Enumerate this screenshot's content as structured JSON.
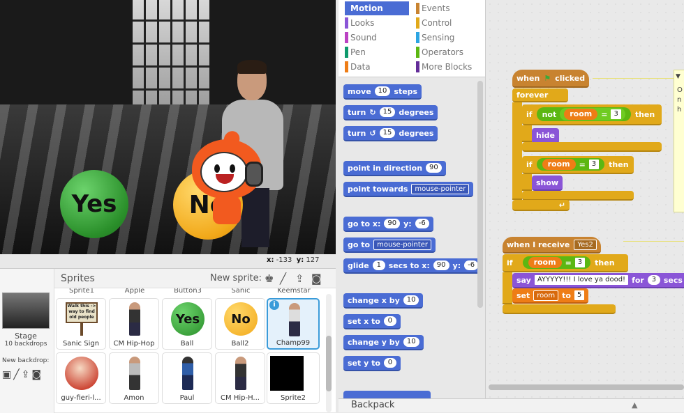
{
  "stage": {
    "yes_label": "Yes",
    "no_label": "No",
    "coords": {
      "x_label": "x:",
      "x_value": "-133",
      "y_label": "y:",
      "y_value": "127"
    }
  },
  "sprites_pane": {
    "title": "Sprites",
    "new_sprite_label": "New sprite:",
    "stage": {
      "label": "Stage",
      "backdrops": "10 backdrops"
    },
    "new_backdrop_label": "New backdrop:",
    "cut_labels": [
      "Sprite1",
      "Apple",
      "Button3",
      "Sanic",
      "Keemstar"
    ],
    "sprites": [
      {
        "name": "Sanic Sign",
        "sign_text": "Walk this -> way to find old people"
      },
      {
        "name": "CM Hip-Hop"
      },
      {
        "name": "Ball",
        "ball_text": "Yes"
      },
      {
        "name": "Ball2",
        "ball_text": "No"
      },
      {
        "name": "Champ99",
        "selected": true,
        "info": "i"
      },
      {
        "name": "guy-fieri-l..."
      },
      {
        "name": "Amon"
      },
      {
        "name": "Paul"
      },
      {
        "name": "CM Hip-H..."
      },
      {
        "name": "Sprite2"
      }
    ]
  },
  "categories": [
    {
      "label": "Motion",
      "color": "#4a6cd4",
      "active": true
    },
    {
      "label": "Looks",
      "color": "#8a55d7"
    },
    {
      "label": "Sound",
      "color": "#bb42c3"
    },
    {
      "label": "Pen",
      "color": "#0e9a6c"
    },
    {
      "label": "Data",
      "color": "#ee7d16"
    },
    {
      "label": "Events",
      "color": "#c88330"
    },
    {
      "label": "Control",
      "color": "#e1a91a"
    },
    {
      "label": "Sensing",
      "color": "#2ca5e2"
    },
    {
      "label": "Operators",
      "color": "#5cb712"
    },
    {
      "label": "More Blocks",
      "color": "#632d99"
    }
  ],
  "palette": {
    "move": {
      "label": "move",
      "value": "10",
      "suffix": "steps"
    },
    "turn_right": {
      "label": "turn",
      "value": "15",
      "suffix": "degrees"
    },
    "turn_left": {
      "label": "turn",
      "value": "15",
      "suffix": "degrees"
    },
    "point_direction": {
      "label": "point in direction",
      "value": "90"
    },
    "point_towards": {
      "label": "point towards",
      "value": "mouse-pointer"
    },
    "goto_xy": {
      "label": "go to x:",
      "x": "90",
      "y_label": "y:",
      "y": "-6"
    },
    "goto": {
      "label": "go to",
      "value": "mouse-pointer"
    },
    "glide": {
      "label": "glide",
      "secs": "1",
      "secs_label": "secs to x:",
      "x": "90",
      "y_label": "y:",
      "y": "-6"
    },
    "change_x": {
      "label": "change x by",
      "value": "10"
    },
    "set_x": {
      "label": "set x to",
      "value": "0"
    },
    "change_y": {
      "label": "change y by",
      "value": "10"
    },
    "set_y": {
      "label": "set y to",
      "value": "0"
    }
  },
  "scripts": {
    "when_flag": {
      "label_when": "when",
      "label_clicked": "clicked"
    },
    "forever": "forever",
    "if1": {
      "if": "if",
      "not": "not",
      "var": "room",
      "eq": "=",
      "value": "3",
      "then": "then"
    },
    "hide": "hide",
    "if2": {
      "if": "if",
      "var": "room",
      "eq": "=",
      "value": "3",
      "then": "then"
    },
    "show": "show",
    "when_receive": {
      "label": "when I receive",
      "message": "Yes2"
    },
    "if3": {
      "if": "if",
      "var": "room",
      "eq": "=",
      "value": "3",
      "then": "then"
    },
    "say": {
      "label": "say",
      "text": "AYYYYY!!! I love ya dood!",
      "for": "for",
      "secs": "3",
      "secs_label": "secs"
    },
    "set_room": {
      "label": "set",
      "var": "room",
      "to": "to",
      "value": "5"
    },
    "note_text": "O\nn\nh"
  },
  "backpack": {
    "label": "Backpack"
  }
}
